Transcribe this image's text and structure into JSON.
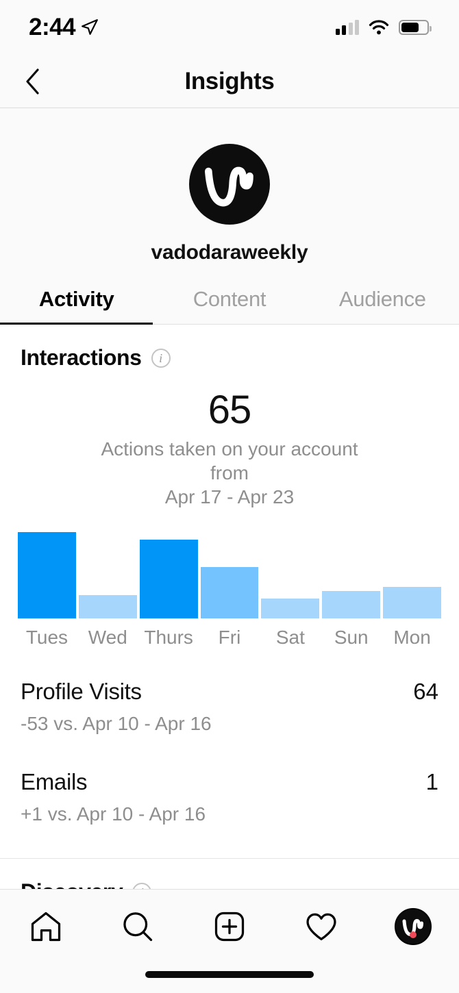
{
  "status_bar": {
    "time": "2:44",
    "location_icon": "location-arrow-icon",
    "cellular_icon": "cellular-signal-icon",
    "cellular_bars_filled": 2,
    "cellular_bars_total": 4,
    "wifi_icon": "wifi-icon",
    "battery_icon": "battery-icon",
    "battery_level_percent": 65
  },
  "navbar": {
    "title": "Insights",
    "back_icon": "chevron-left-icon"
  },
  "profile": {
    "username": "vadodaraweekly",
    "avatar_icon": "profile-avatar-logo"
  },
  "tabs": [
    {
      "label": "Activity",
      "active": true
    },
    {
      "label": "Content",
      "active": false
    },
    {
      "label": "Audience",
      "active": false
    }
  ],
  "interactions": {
    "title": "Interactions",
    "info_icon": "info-icon",
    "value": "65",
    "caption_line1": "Actions taken on your account",
    "caption_line2": "from",
    "caption_line3": "Apr 17 - Apr 23"
  },
  "chart_data": {
    "type": "bar",
    "title": "Interactions",
    "categories": [
      "Tues",
      "Wed",
      "Thurs",
      "Fri",
      "Sat",
      "Sun",
      "Mon"
    ],
    "values": [
      22,
      6,
      20,
      13,
      5,
      7,
      8
    ],
    "bar_colors": [
      "#0095F6",
      "#A6D6FC",
      "#0095F6",
      "#74C3FE",
      "#A6D6FC",
      "#A6D6FC",
      "#A6D6FC"
    ],
    "xlabel": "",
    "ylabel": "",
    "ylim": [
      0,
      22
    ],
    "grid": false,
    "legend": "none"
  },
  "stats": [
    {
      "name": "Profile Visits",
      "value": "64",
      "comparison": "-53 vs. Apr 10 - Apr 16"
    },
    {
      "name": "Emails",
      "value": "1",
      "comparison": "+1 vs. Apr 10 - Apr 16"
    }
  ],
  "discovery": {
    "title": "Discovery",
    "info_icon": "info-icon"
  },
  "tabbar": {
    "items": [
      {
        "icon": "home-icon",
        "label": "Home"
      },
      {
        "icon": "search-icon",
        "label": "Search"
      },
      {
        "icon": "add-post-icon",
        "label": "New Post"
      },
      {
        "icon": "heart-icon",
        "label": "Activity"
      },
      {
        "icon": "profile-avatar-icon",
        "label": "Profile"
      }
    ],
    "profile_badge": true
  },
  "colors": {
    "accent_blue": "#0095F6",
    "mid_blue": "#74C3FE",
    "light_blue": "#A6D6FC",
    "notification_red": "#ED4956",
    "muted_text": "#8E8E8E",
    "background": "#FAFAFA"
  }
}
